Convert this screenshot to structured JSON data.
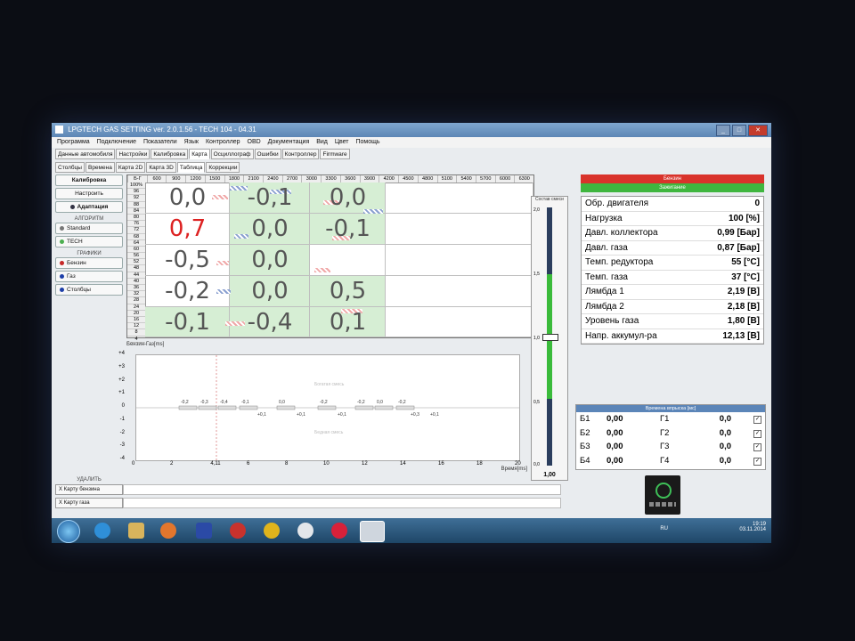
{
  "window": {
    "title": "LPGTECH GAS SETTING ver. 2.0.1.56 - TECH 104 - 04.31"
  },
  "menu": [
    "Программа",
    "Подключение",
    "Показатели",
    "Язык",
    "Контроллер",
    "OBD",
    "Документация",
    "Вид",
    "Цвет",
    "Помощь"
  ],
  "tabs_main": [
    "Данные автомобиля",
    "Настройки",
    "Калибровка",
    "Карта",
    "Осциллограф",
    "Ошибки",
    "Контроллер",
    "Firmware"
  ],
  "tabs_map": [
    "Столбцы",
    "Времена",
    "Карта 2D",
    "Карта 3D",
    "Таблица",
    "Коррекции"
  ],
  "left": {
    "calibration": "Калибровка",
    "settings": "Настроить",
    "adaptation": "Адаптация",
    "algorithm_title": "АЛГОРИТМ",
    "algo_standard": "Standard",
    "algo_tech": "TECH",
    "graphs_title": "ГРАФИКИ",
    "graph_petrol": "Бензин",
    "graph_gas": "Газ",
    "graph_columns": "Столбцы",
    "delete_title": "УДАЛИТЬ",
    "del_petrol": "X Карту бензина",
    "del_gas": "X Карту газа"
  },
  "map": {
    "corner": "Б-Г",
    "rpm": [
      "600",
      "900",
      "1200",
      "1500",
      "1800",
      "2100",
      "2400",
      "2700",
      "3000",
      "3300",
      "3600",
      "3900",
      "4200",
      "4500",
      "4800",
      "5100",
      "5400",
      "5700",
      "6000",
      "6300"
    ],
    "load": [
      "100%",
      "96",
      "92",
      "88",
      "84",
      "80",
      "76",
      "72",
      "68",
      "64",
      "60",
      "56",
      "52",
      "48",
      "44",
      "40",
      "36",
      "32",
      "28",
      "24",
      "20",
      "16",
      "12",
      "8",
      "4"
    ],
    "values": [
      [
        "0,0",
        "-0,1",
        "0,0"
      ],
      [
        "0,7",
        "0,0",
        "-0,1"
      ],
      [
        "-0,5",
        "0,0",
        ""
      ],
      [
        "-0,2",
        "0,0",
        "0,5"
      ],
      [
        "-0,1",
        "-0,4",
        "0,1"
      ]
    ]
  },
  "osc": {
    "title": "Бензин-Газ[ms]",
    "y_ticks": [
      "+4",
      "+3",
      "+2",
      "+1",
      "0",
      "-1",
      "-2",
      "-3",
      "-4"
    ],
    "x_ticks": [
      "0",
      "2",
      "4,11",
      "6",
      "8",
      "10",
      "12",
      "14",
      "16",
      "18",
      "20"
    ],
    "x_label": "Время[ms]",
    "rich_label": "Богатая смесь",
    "lean_label": "Бедная смесь",
    "bar_labels_top": [
      "-0,2",
      "-0,3",
      "-0,4",
      "-0,1",
      "0,0",
      "-0,2",
      "-0,2",
      "0,0",
      "-0,2"
    ],
    "bar_labels_bottom": [
      "+0,1",
      "+0,1",
      "+0,1",
      "+0,3",
      "+0,1"
    ]
  },
  "mixture": {
    "title": "Состав смеси",
    "scale_top": "2,0",
    "scale_mid": "1,5",
    "scale_one": "1,0",
    "scale_low": "0,5",
    "scale_zero": "0,0",
    "value": "1,00",
    "level": 0.5
  },
  "status": {
    "petrol": "Бензин",
    "ignition": "Зажигание"
  },
  "params": [
    {
      "label": "Обр. двигателя",
      "value": "0"
    },
    {
      "label": "Нагрузка",
      "value": "100 [%]"
    },
    {
      "label": "Давл. коллектора",
      "value": "0,99 [Бар]"
    },
    {
      "label": "Давл. газа",
      "value": "0,87 [Бар]"
    },
    {
      "label": "Темп. редуктора",
      "value": "55 [°C]"
    },
    {
      "label": "Темп. газа",
      "value": "37 [°C]"
    },
    {
      "label": "Лямбда 1",
      "value": "2,19 [В]"
    },
    {
      "label": "Лямбда 2",
      "value": "2,18 [В]"
    },
    {
      "label": "Уровень газа",
      "value": "1,80 [В]"
    },
    {
      "label": "Напр. аккумул-ра",
      "value": "12,13 [В]"
    }
  ],
  "injection": {
    "title": "Времена впрыска [мс]",
    "rows": [
      {
        "b": "Б1",
        "bv": "0,00",
        "g": "Г1",
        "gv": "0,0"
      },
      {
        "b": "Б2",
        "bv": "0,00",
        "g": "Г2",
        "gv": "0,0"
      },
      {
        "b": "Б3",
        "bv": "0,00",
        "g": "Г3",
        "gv": "0,0"
      },
      {
        "b": "Б4",
        "bv": "0,00",
        "g": "Г4",
        "gv": "0,0"
      }
    ]
  },
  "tray": {
    "lang": "RU",
    "time": "19:19",
    "date": "03.11.2014"
  }
}
